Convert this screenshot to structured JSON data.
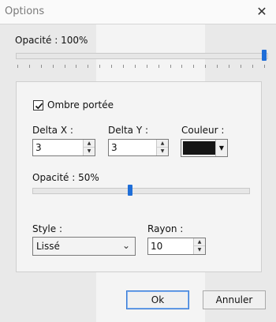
{
  "window": {
    "title": "Options"
  },
  "opacity": {
    "label": "Opacité : 100%",
    "value_percent": 100
  },
  "shadow": {
    "enabled": true,
    "label": "Ombre portée",
    "delta_x": {
      "label": "Delta X :",
      "value": "3"
    },
    "delta_y": {
      "label": "Delta Y :",
      "value": "3"
    },
    "color": {
      "label": "Couleur :",
      "value": "#151515"
    },
    "opacity": {
      "label": "Opacité : 50%",
      "value_percent": 50
    },
    "style": {
      "label": "Style :",
      "value": "Lissé"
    },
    "radius": {
      "label": "Rayon :",
      "value": "10"
    }
  },
  "buttons": {
    "ok": "Ok",
    "cancel": "Annuler"
  }
}
